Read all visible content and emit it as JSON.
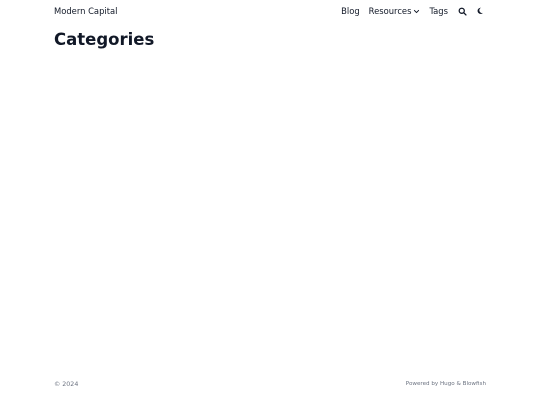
{
  "header": {
    "site_title": "Modern Capital",
    "nav": {
      "blog": "Blog",
      "resources": "Resources",
      "tags": "Tags"
    }
  },
  "main": {
    "title": "Categories"
  },
  "footer": {
    "copyright": "© 2024",
    "powered_by": "Powered by Hugo & Blowfish"
  },
  "colors": {
    "text": "#111827",
    "muted": "#6b7280",
    "background": "#ffffff"
  },
  "icons": {
    "search": "search-icon",
    "theme": "moon-icon",
    "dropdown": "chevron-down-icon"
  }
}
